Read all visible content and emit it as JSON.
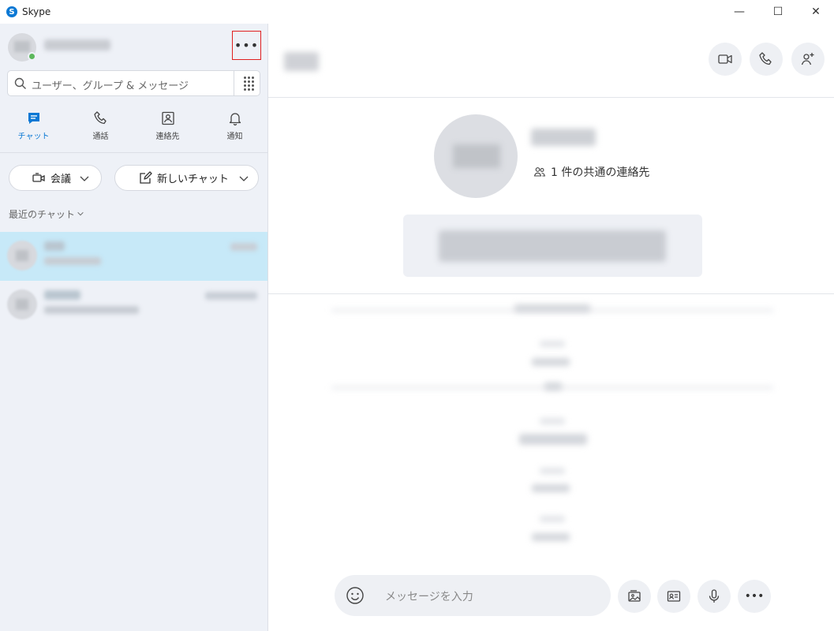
{
  "window": {
    "title": "Skype",
    "logo_letter": "S",
    "minimize_glyph": "—",
    "maximize_glyph": "☐",
    "close_glyph": "✕"
  },
  "sidebar": {
    "more_label": "•••",
    "search_placeholder": "ユーザー、グループ & メッセージ",
    "nav": [
      {
        "label": "チャット",
        "icon": "chat-icon",
        "active": true
      },
      {
        "label": "通話",
        "icon": "phone-icon",
        "active": false
      },
      {
        "label": "連絡先",
        "icon": "contacts-icon",
        "active": false
      },
      {
        "label": "通知",
        "icon": "bell-icon",
        "active": false
      }
    ],
    "meeting_label": "会議",
    "new_chat_label": "新しいチャット",
    "recent_label": "最近のチャット"
  },
  "main": {
    "mutual_contacts": "1 件の共通の連絡先",
    "composer_placeholder": "メッセージを入力",
    "more_label": "•••"
  },
  "colors": {
    "accent": "#0a78d4",
    "selected_row": "#c7e9f8",
    "online": "#5cb85c",
    "highlight_box": "#e02020"
  }
}
